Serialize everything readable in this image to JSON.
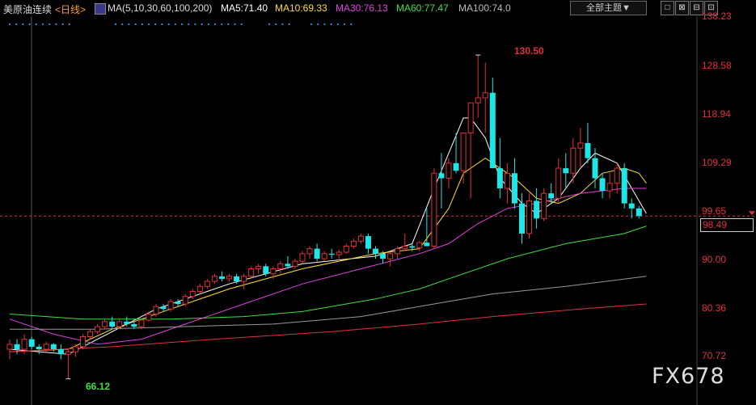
{
  "header": {
    "instrument": "美原油连续",
    "period": "<日线>",
    "ma_label": "MA(5,10,30,60,100,200)",
    "ma_values": [
      {
        "text": "MA5:71.40",
        "color": "#ffffff"
      },
      {
        "text": "MA10:69.33",
        "color": "#ffdd33"
      },
      {
        "text": "MA30:76.13",
        "color": "#e040e0"
      },
      {
        "text": "MA60:77.47",
        "color": "#40e040"
      },
      {
        "text": "MA100:74.0",
        "color": "#bbbbbb"
      }
    ],
    "theme_selector": "全部主题▼",
    "buttons": [
      "□",
      "⊠",
      "⊟",
      "⊡"
    ]
  },
  "price_axis": [
    "138.23",
    "128.58",
    "118.94",
    "109.29",
    "99.65",
    "90.00",
    "80.36",
    "70.72"
  ],
  "last_price": "98.49",
  "annotations": {
    "high": "130.50",
    "low": "66.12"
  },
  "watermark": "FX678",
  "colors": {
    "up": "#e0313a",
    "down": "#1ee6e6",
    "ma5": "#ffffff",
    "ma10": "#ffdd33",
    "ma30": "#e040e0",
    "ma60": "#40e040",
    "ma100": "#999999",
    "ma200": "#e0313a"
  },
  "chart_data": {
    "type": "candlestick",
    "ylim": [
      70.72,
      138.23
    ],
    "candles": [
      {
        "o": 72,
        "h": 74,
        "l": 70,
        "c": 73
      },
      {
        "o": 73,
        "h": 74,
        "l": 71,
        "c": 72
      },
      {
        "o": 72,
        "h": 75,
        "l": 71,
        "c": 74
      },
      {
        "o": 74,
        "h": 74.5,
        "l": 72,
        "c": 72.5
      },
      {
        "o": 72.5,
        "h": 73,
        "l": 71,
        "c": 72
      },
      {
        "o": 72,
        "h": 73.5,
        "l": 71.5,
        "c": 73
      },
      {
        "o": 73,
        "h": 73.2,
        "l": 71.5,
        "c": 72
      },
      {
        "o": 72,
        "h": 73,
        "l": 70,
        "c": 71
      },
      {
        "o": 71,
        "h": 72,
        "l": 66.12,
        "c": 71.5
      },
      {
        "o": 71.5,
        "h": 73,
        "l": 70.5,
        "c": 72.5
      },
      {
        "o": 72.5,
        "h": 75,
        "l": 72,
        "c": 74.5
      },
      {
        "o": 74.5,
        "h": 76,
        "l": 74,
        "c": 75.5
      },
      {
        "o": 75.5,
        "h": 77,
        "l": 75,
        "c": 76.5
      },
      {
        "o": 76.5,
        "h": 78,
        "l": 76,
        "c": 77.5
      },
      {
        "o": 77.5,
        "h": 78.5,
        "l": 76,
        "c": 76.5
      },
      {
        "o": 76.5,
        "h": 78,
        "l": 76,
        "c": 77.5
      },
      {
        "o": 77.5,
        "h": 78.5,
        "l": 76.5,
        "c": 77
      },
      {
        "o": 77,
        "h": 78,
        "l": 76,
        "c": 76.5
      },
      {
        "o": 76.5,
        "h": 78,
        "l": 76,
        "c": 77.8
      },
      {
        "o": 77.8,
        "h": 79.5,
        "l": 77.5,
        "c": 79
      },
      {
        "o": 79,
        "h": 81,
        "l": 78.5,
        "c": 80.5
      },
      {
        "o": 80.5,
        "h": 81,
        "l": 79.5,
        "c": 80
      },
      {
        "o": 80,
        "h": 82,
        "l": 79.5,
        "c": 81.5
      },
      {
        "o": 81.5,
        "h": 82,
        "l": 80.5,
        "c": 81
      },
      {
        "o": 81,
        "h": 83,
        "l": 80.5,
        "c": 82.5
      },
      {
        "o": 82.5,
        "h": 84,
        "l": 82,
        "c": 83.5
      },
      {
        "o": 83.5,
        "h": 85,
        "l": 83,
        "c": 84.5
      },
      {
        "o": 84.5,
        "h": 86,
        "l": 84,
        "c": 85.5
      },
      {
        "o": 85.5,
        "h": 87,
        "l": 85,
        "c": 86.5
      },
      {
        "o": 86.5,
        "h": 87.5,
        "l": 85.5,
        "c": 86
      },
      {
        "o": 86,
        "h": 87,
        "l": 85.5,
        "c": 86.5
      },
      {
        "o": 86.5,
        "h": 87,
        "l": 85,
        "c": 85.5
      },
      {
        "o": 85.5,
        "h": 87,
        "l": 84,
        "c": 86.5
      },
      {
        "o": 86.5,
        "h": 88.5,
        "l": 86,
        "c": 88
      },
      {
        "o": 88,
        "h": 89,
        "l": 87,
        "c": 88.5
      },
      {
        "o": 88.5,
        "h": 89,
        "l": 86.5,
        "c": 87
      },
      {
        "o": 87,
        "h": 88.5,
        "l": 86,
        "c": 88
      },
      {
        "o": 88,
        "h": 89.5,
        "l": 87,
        "c": 89
      },
      {
        "o": 89,
        "h": 90.5,
        "l": 88,
        "c": 88.5
      },
      {
        "o": 88.5,
        "h": 90,
        "l": 88,
        "c": 89.5
      },
      {
        "o": 89.5,
        "h": 91.5,
        "l": 89,
        "c": 91
      },
      {
        "o": 91,
        "h": 92.5,
        "l": 90,
        "c": 92
      },
      {
        "o": 92,
        "h": 93,
        "l": 89.5,
        "c": 90
      },
      {
        "o": 90,
        "h": 91.5,
        "l": 89.5,
        "c": 91
      },
      {
        "o": 91,
        "h": 92,
        "l": 90,
        "c": 90.8
      },
      {
        "o": 90.8,
        "h": 91.8,
        "l": 89.5,
        "c": 91.3
      },
      {
        "o": 91.3,
        "h": 93,
        "l": 91,
        "c": 92.5
      },
      {
        "o": 92.5,
        "h": 94,
        "l": 92,
        "c": 93.5
      },
      {
        "o": 93.5,
        "h": 95,
        "l": 93,
        "c": 94.5
      },
      {
        "o": 94.5,
        "h": 95,
        "l": 91,
        "c": 92
      },
      {
        "o": 92,
        "h": 92.5,
        "l": 90,
        "c": 91
      },
      {
        "o": 91,
        "h": 91.5,
        "l": 89,
        "c": 90
      },
      {
        "o": 90,
        "h": 91.5,
        "l": 88.5,
        "c": 91
      },
      {
        "o": 91,
        "h": 92.5,
        "l": 90,
        "c": 92
      },
      {
        "o": 92,
        "h": 95,
        "l": 91.5,
        "c": 92.5
      },
      {
        "o": 92.5,
        "h": 93,
        "l": 91.5,
        "c": 92.2
      },
      {
        "o": 92.2,
        "h": 93.5,
        "l": 91.5,
        "c": 93.2
      },
      {
        "o": 93.2,
        "h": 100,
        "l": 92.5,
        "c": 92.5
      },
      {
        "o": 92.5,
        "h": 108,
        "l": 92,
        "c": 107
      },
      {
        "o": 107,
        "h": 111,
        "l": 100,
        "c": 106
      },
      {
        "o": 106,
        "h": 110,
        "l": 104,
        "c": 109
      },
      {
        "o": 109,
        "h": 115,
        "l": 107,
        "c": 107.5
      },
      {
        "o": 107.5,
        "h": 115,
        "l": 105,
        "c": 115
      },
      {
        "o": 115,
        "h": 116,
        "l": 102,
        "c": 121
      },
      {
        "o": 121,
        "h": 130.5,
        "l": 118,
        "c": 122
      },
      {
        "o": 122,
        "h": 129,
        "l": 115,
        "c": 123
      },
      {
        "o": 123,
        "h": 126,
        "l": 108,
        "c": 108
      },
      {
        "o": 108,
        "h": 114,
        "l": 102,
        "c": 104
      },
      {
        "o": 104,
        "h": 109,
        "l": 101,
        "c": 107
      },
      {
        "o": 107,
        "h": 110,
        "l": 100,
        "c": 101
      },
      {
        "o": 101,
        "h": 103,
        "l": 93,
        "c": 95
      },
      {
        "o": 95,
        "h": 103,
        "l": 94,
        "c": 101.5
      },
      {
        "o": 101.5,
        "h": 104,
        "l": 96,
        "c": 98
      },
      {
        "o": 98,
        "h": 104,
        "l": 97.5,
        "c": 103
      },
      {
        "o": 103,
        "h": 105,
        "l": 101,
        "c": 102
      },
      {
        "o": 102,
        "h": 110,
        "l": 101,
        "c": 108
      },
      {
        "o": 108,
        "h": 111,
        "l": 104,
        "c": 107
      },
      {
        "o": 107,
        "h": 114,
        "l": 105,
        "c": 112
      },
      {
        "o": 112,
        "h": 116,
        "l": 108,
        "c": 113
      },
      {
        "o": 113,
        "h": 117,
        "l": 109,
        "c": 110
      },
      {
        "o": 110,
        "h": 112,
        "l": 104,
        "c": 106
      },
      {
        "o": 106,
        "h": 107,
        "l": 102,
        "c": 103.5
      },
      {
        "o": 103.5,
        "h": 107,
        "l": 102,
        "c": 105
      },
      {
        "o": 105,
        "h": 109,
        "l": 103,
        "c": 108
      },
      {
        "o": 108,
        "h": 109,
        "l": 100,
        "c": 101
      },
      {
        "o": 101,
        "h": 102,
        "l": 98,
        "c": 100
      },
      {
        "o": 100,
        "h": 100.5,
        "l": 98,
        "c": 98.49
      }
    ],
    "moving_averages": [
      {
        "name": "MA5",
        "values": [
          [
            0,
            72
          ],
          [
            8,
            71
          ],
          [
            12,
            74
          ],
          [
            20,
            80
          ],
          [
            30,
            85
          ],
          [
            40,
            89
          ],
          [
            50,
            90.5
          ],
          [
            55,
            93
          ],
          [
            58,
            104
          ],
          [
            62,
            118
          ],
          [
            63,
            118
          ],
          [
            65,
            114
          ],
          [
            67,
            106
          ],
          [
            70,
            101
          ],
          [
            72,
            99
          ],
          [
            75,
            102
          ],
          [
            78,
            108
          ],
          [
            80,
            111
          ],
          [
            83,
            109
          ],
          [
            85,
            104
          ],
          [
            87,
            99
          ]
        ]
      },
      {
        "name": "MA10",
        "values": [
          [
            0,
            71.5
          ],
          [
            8,
            72
          ],
          [
            14,
            76
          ],
          [
            22,
            80
          ],
          [
            30,
            84
          ],
          [
            40,
            88
          ],
          [
            50,
            91
          ],
          [
            56,
            92
          ],
          [
            60,
            100
          ],
          [
            62,
            107
          ],
          [
            65,
            110
          ],
          [
            69,
            106
          ],
          [
            72,
            102
          ],
          [
            75,
            101
          ],
          [
            78,
            103
          ],
          [
            81,
            107
          ],
          [
            84,
            108
          ],
          [
            86,
            107
          ],
          [
            87,
            105
          ]
        ]
      },
      {
        "name": "MA30",
        "values": [
          [
            0,
            78
          ],
          [
            6,
            75
          ],
          [
            12,
            73
          ],
          [
            18,
            74
          ],
          [
            24,
            77
          ],
          [
            32,
            81
          ],
          [
            40,
            85
          ],
          [
            48,
            88
          ],
          [
            56,
            91
          ],
          [
            60,
            93
          ],
          [
            64,
            97
          ],
          [
            68,
            100
          ],
          [
            72,
            101
          ],
          [
            78,
            103
          ],
          [
            84,
            104
          ],
          [
            87,
            104
          ]
        ]
      },
      {
        "name": "MA60",
        "values": [
          [
            0,
            79
          ],
          [
            10,
            78
          ],
          [
            22,
            78
          ],
          [
            32,
            78.5
          ],
          [
            40,
            79.5
          ],
          [
            50,
            82
          ],
          [
            56,
            84
          ],
          [
            62,
            87
          ],
          [
            68,
            90
          ],
          [
            76,
            93
          ],
          [
            84,
            95
          ],
          [
            87,
            96.5
          ]
        ]
      },
      {
        "name": "MA100",
        "values": [
          [
            0,
            76
          ],
          [
            12,
            76
          ],
          [
            24,
            76.5
          ],
          [
            36,
            77
          ],
          [
            48,
            78.5
          ],
          [
            58,
            81
          ],
          [
            66,
            83
          ],
          [
            76,
            84.5
          ],
          [
            87,
            86.5
          ]
        ]
      },
      {
        "name": "MA200",
        "values": [
          [
            0,
            71.5
          ],
          [
            14,
            72.5
          ],
          [
            28,
            74
          ],
          [
            44,
            75.5
          ],
          [
            56,
            77
          ],
          [
            66,
            78.5
          ],
          [
            78,
            80
          ],
          [
            87,
            81
          ]
        ]
      }
    ]
  }
}
